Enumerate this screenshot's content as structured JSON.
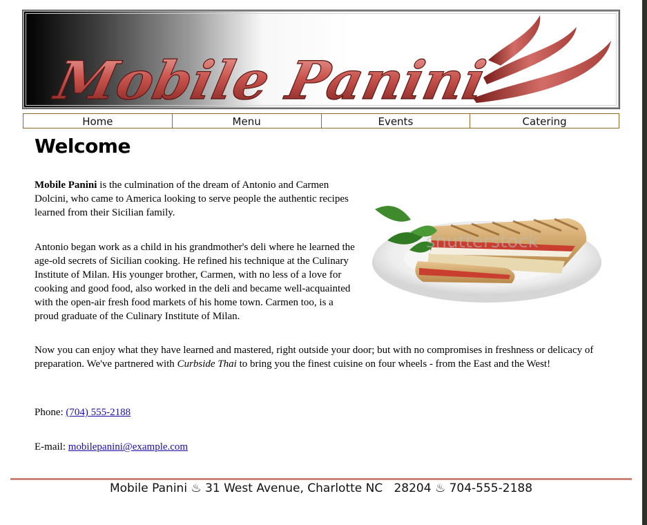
{
  "banner": {
    "brand_text": "Mobile Panini"
  },
  "nav": {
    "items": [
      {
        "label": "Home"
      },
      {
        "label": "Menu"
      },
      {
        "label": "Events"
      },
      {
        "label": "Catering"
      }
    ]
  },
  "main": {
    "heading": "Welcome",
    "p1_bold": "Mobile Panini",
    "p1_text": " is the culmination of the dream of Antonio and Carmen Dolcini, who came to America looking to serve people the authentic recipes learned from their Sicilian family.",
    "p2_text": "Antonio began work as a child in his grandmother's deli where he learned the age-old secrets of Sicilian cooking. He refined his technique at the Culinary Institute of Milan. His younger brother, Carmen, with no less of a love for cooking and good food, also worked in the deli and became well-acquainted with the open-air fresh food markets of his home town. Carmen too, is a proud graduate of the Culinary Institute of Milan.",
    "p3_before": "Now you can enjoy what they have learned and mastered, right outside your door; but with no compromises in freshness or delicacy of preparation. We've partnered with ",
    "p3_italic": "Curbside Thai",
    "p3_after": " to bring you the finest cuisine on four wheels - from the East and the West!",
    "phone_label": "Phone: ",
    "phone_link": "(704) 555-2188",
    "email_label": "E-mail: ",
    "email_link": "mobilepanini@example.com",
    "photo_watermark": "shutterstock"
  },
  "footer": {
    "text": "Mobile Panini ♨ 31 West Avenue, Charlotte NC   28204 ♨ 704-555-2188"
  },
  "colors": {
    "nav_border": "#8a6a1e",
    "brand_red": "#c0504d",
    "footer_rule": "#c98477",
    "link": "#1a0dab"
  }
}
